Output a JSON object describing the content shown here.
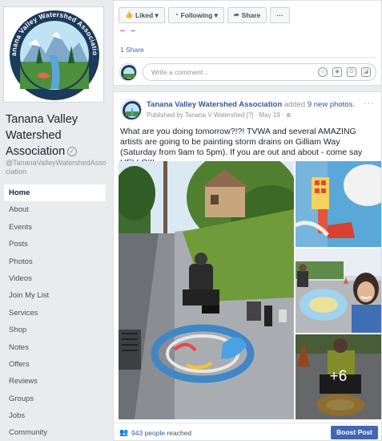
{
  "page": {
    "name": "Tanana Valley Watershed Association",
    "handle": "@TananaValleyWatershedAssociation",
    "logo_text": "Tanana Valley Watershed Association"
  },
  "nav": {
    "items": [
      {
        "id": "home",
        "label": "Home",
        "active": true
      },
      {
        "id": "about",
        "label": "About"
      },
      {
        "id": "events",
        "label": "Events"
      },
      {
        "id": "posts",
        "label": "Posts"
      },
      {
        "id": "photos",
        "label": "Photos"
      },
      {
        "id": "videos",
        "label": "Videos"
      },
      {
        "id": "join-my-list",
        "label": "Join My List"
      },
      {
        "id": "services",
        "label": "Services"
      },
      {
        "id": "shop",
        "label": "Shop"
      },
      {
        "id": "notes",
        "label": "Notes"
      },
      {
        "id": "offers",
        "label": "Offers"
      },
      {
        "id": "reviews",
        "label": "Reviews"
      },
      {
        "id": "groups",
        "label": "Groups"
      },
      {
        "id": "jobs",
        "label": "Jobs"
      },
      {
        "id": "community",
        "label": "Community"
      }
    ]
  },
  "top_card": {
    "actions": [
      {
        "id": "liked",
        "label": "Liked ▾",
        "icon": "thumbs-up-icon"
      },
      {
        "id": "following",
        "label": "Following ▾",
        "icon": "rss-icon"
      },
      {
        "id": "share",
        "label": "Share",
        "icon": "share-arrow-icon"
      },
      {
        "id": "more",
        "label": "···",
        "icon": ""
      }
    ],
    "share_count": "1 Share",
    "comment_placeholder": "Write a comment..."
  },
  "post": {
    "author": "Tanana Valley Watershed Association",
    "added_text": "added",
    "photos_link": "9 new photos.",
    "published_by": "Published by Tanana V Watershed [?] · May 19 ·",
    "text": "What are you doing tomorrow?!?! TVWA and several AMAZING artists are going to be painting storm drains on Gilliam Way (Saturday from 9am to 5pm). If you are out and about - come say HELLO!!!",
    "more_photos_count": "+6",
    "reach_number": "943 people",
    "reach_suffix": " reached",
    "boost_label": "Boost Post"
  },
  "colors": {
    "facebook_blue": "#4267b2",
    "link_blue": "#365899",
    "background": "#e9ebee"
  }
}
